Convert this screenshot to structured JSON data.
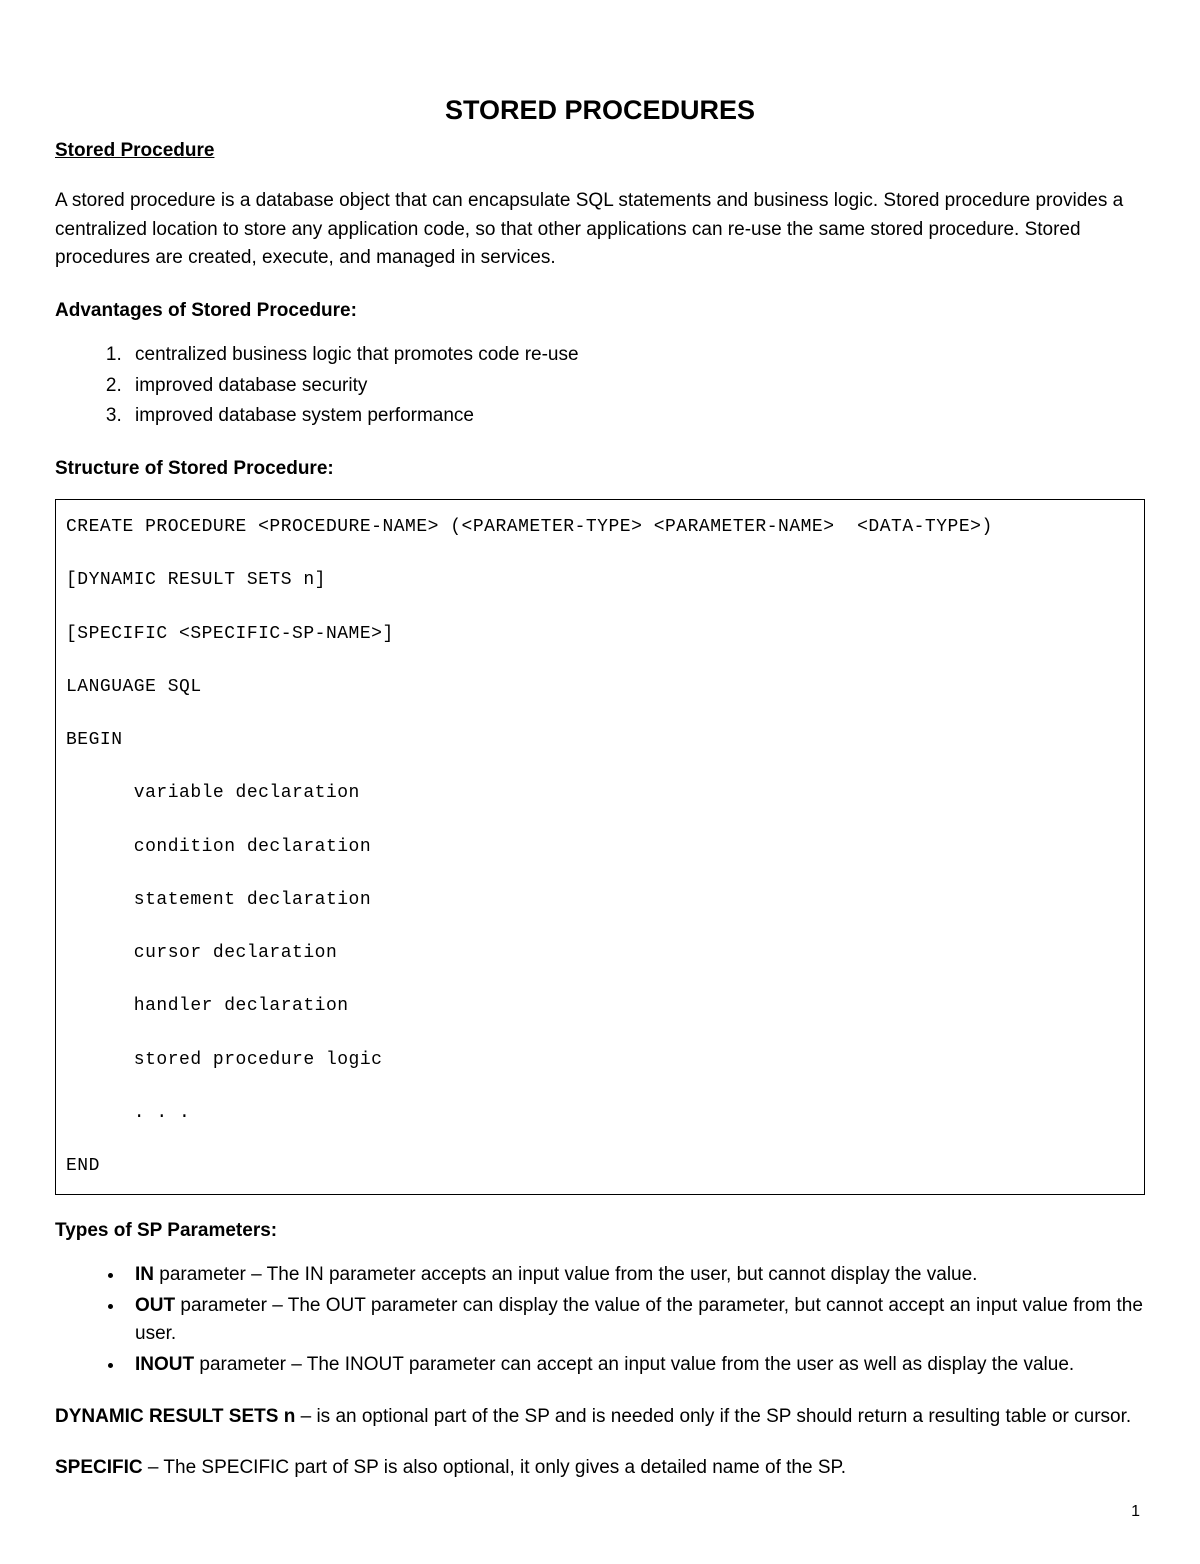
{
  "title": "STORED PROCEDURES",
  "heading1": "Stored Procedure",
  "intro": "A stored procedure is a database object that can encapsulate SQL statements and business logic. Stored procedure provides a centralized location to store any application code, so that other applications can re-use the same stored procedure. Stored procedures are created, execute, and managed in services.",
  "advantagesHeading": "Advantages of Stored Procedure:",
  "advantages": [
    "centralized business logic that promotes code re-use",
    "improved database security",
    "improved database system performance"
  ],
  "structureHeading": "Structure of Stored Procedure:",
  "codeBlock": "CREATE PROCEDURE <PROCEDURE-NAME> (<PARAMETER-TYPE> <PARAMETER-NAME>  <DATA-TYPE>)\n\n[DYNAMIC RESULT SETS n]\n\n[SPECIFIC <SPECIFIC-SP-NAME>]\n\nLANGUAGE SQL\n\nBEGIN\n\n      variable declaration\n\n      condition declaration\n\n      statement declaration\n\n      cursor declaration\n\n      handler declaration\n\n      stored procedure logic\n\n      . . .\n\nEND",
  "paramsHeading": "Types of SP Parameters:",
  "params": [
    {
      "name": "IN",
      "desc": " parameter – The IN parameter accepts an input value from the user, but cannot display the value."
    },
    {
      "name": "OUT",
      "desc": " parameter – The OUT parameter can display the value of the parameter, but cannot accept an input value from the user."
    },
    {
      "name": "INOUT",
      "desc": " parameter – The INOUT parameter can accept an input value from the user as well as display the value."
    }
  ],
  "dynResultLabel": "DYNAMIC RESULT SETS n",
  "dynResultDesc": " – is an optional part of the SP and is needed only if the SP should return a resulting table or cursor.",
  "specificLabel": "SPECIFIC",
  "specificDesc": " – The SPECIFIC part of SP is also optional, it only gives a detailed name of the SP.",
  "pageNumber": "1"
}
